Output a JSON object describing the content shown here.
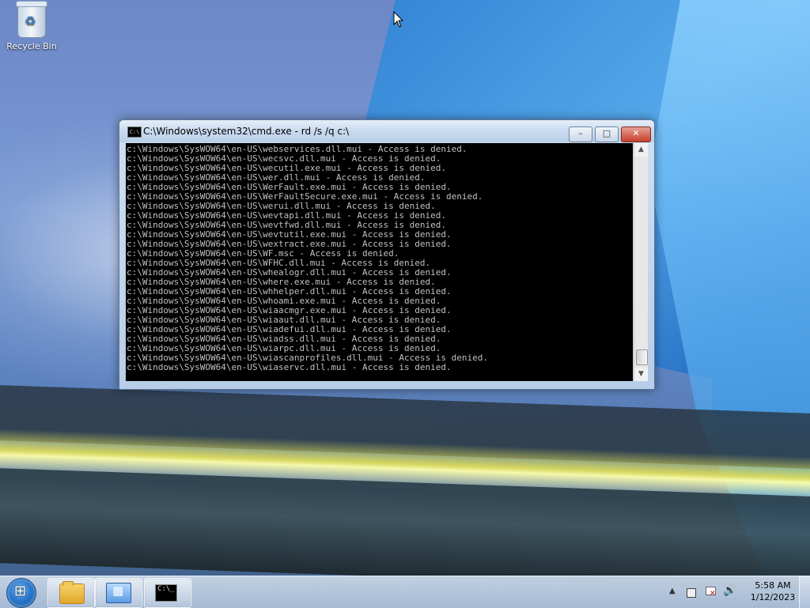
{
  "desktop": {
    "icons": [
      {
        "label": "Recycle Bin",
        "icon": "recycle-bin-icon"
      }
    ]
  },
  "window": {
    "title": "C:\\Windows\\system32\\cmd.exe - rd  /s /q c:\\",
    "icon": "cmd-icon",
    "buttons": {
      "minimize": "–",
      "maximize": "□",
      "close": "✕"
    },
    "console_lines": [
      "c:\\Windows\\SysWOW64\\en-US\\webservices.dll.mui - Access is denied.",
      "c:\\Windows\\SysWOW64\\en-US\\wecsvc.dll.mui - Access is denied.",
      "c:\\Windows\\SysWOW64\\en-US\\wecutil.exe.mui - Access is denied.",
      "c:\\Windows\\SysWOW64\\en-US\\wer.dll.mui - Access is denied.",
      "c:\\Windows\\SysWOW64\\en-US\\WerFault.exe.mui - Access is denied.",
      "c:\\Windows\\SysWOW64\\en-US\\WerFaultSecure.exe.mui - Access is denied.",
      "c:\\Windows\\SysWOW64\\en-US\\werui.dll.mui - Access is denied.",
      "c:\\Windows\\SysWOW64\\en-US\\wevtapi.dll.mui - Access is denied.",
      "c:\\Windows\\SysWOW64\\en-US\\wevtfwd.dll.mui - Access is denied.",
      "c:\\Windows\\SysWOW64\\en-US\\wevtutil.exe.mui - Access is denied.",
      "c:\\Windows\\SysWOW64\\en-US\\wextract.exe.mui - Access is denied.",
      "c:\\Windows\\SysWOW64\\en-US\\WF.msc - Access is denied.",
      "c:\\Windows\\SysWOW64\\en-US\\WFHC.dll.mui - Access is denied.",
      "c:\\Windows\\SysWOW64\\en-US\\whealogr.dll.mui - Access is denied.",
      "c:\\Windows\\SysWOW64\\en-US\\where.exe.mui - Access is denied.",
      "c:\\Windows\\SysWOW64\\en-US\\whhelper.dll.mui - Access is denied.",
      "c:\\Windows\\SysWOW64\\en-US\\whoami.exe.mui - Access is denied.",
      "c:\\Windows\\SysWOW64\\en-US\\wiaacmgr.exe.mui - Access is denied.",
      "c:\\Windows\\SysWOW64\\en-US\\wiaaut.dll.mui - Access is denied.",
      "c:\\Windows\\SysWOW64\\en-US\\wiadefui.dll.mui - Access is denied.",
      "c:\\Windows\\SysWOW64\\en-US\\wiadss.dll.mui - Access is denied.",
      "c:\\Windows\\SysWOW64\\en-US\\wiarpc.dll.mui - Access is denied.",
      "c:\\Windows\\SysWOW64\\en-US\\wiascanprofiles.dll.mui - Access is denied.",
      "c:\\Windows\\SysWOW64\\en-US\\wiaservc.dll.mui - Access is denied."
    ],
    "scrollbar": {
      "up_arrow": "▲",
      "down_arrow": "▼"
    }
  },
  "taskbar": {
    "start_icon": "windows-start-icon",
    "pinned": [
      {
        "name": "explorer",
        "icon": "folder-icon"
      },
      {
        "name": "control-panel",
        "icon": "control-panel-icon"
      },
      {
        "name": "command-prompt",
        "icon": "cmd-icon",
        "active": true,
        "glyph": "C:\\_"
      }
    ],
    "tray": {
      "arrow": "▲",
      "icons": [
        "network-icon",
        "action-center-flag-icon",
        "volume-icon"
      ],
      "volume_glyph": "🔊"
    },
    "clock": {
      "time": "5:58 AM",
      "date": "1/12/2023"
    }
  },
  "colors": {
    "console_bg": "#000000",
    "console_fg": "#c0c0c0",
    "close_button": "#c6402c"
  }
}
